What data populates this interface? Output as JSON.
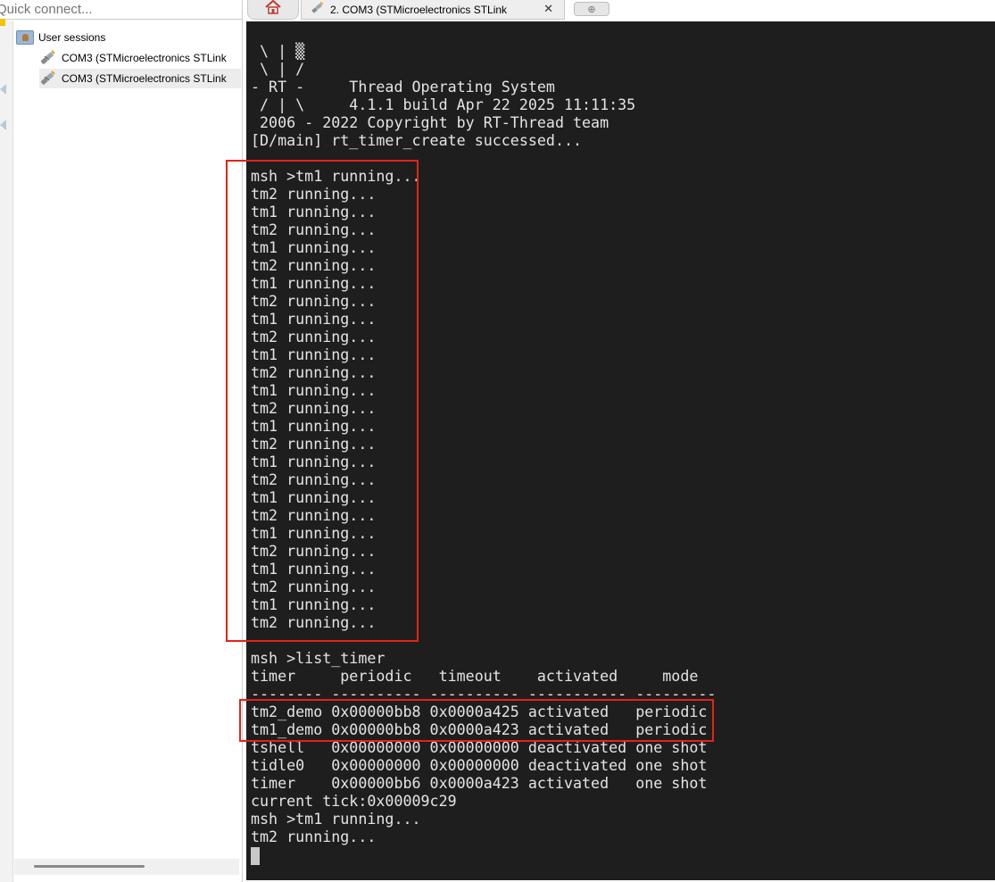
{
  "quick_connect": {
    "placeholder": "Quick connect..."
  },
  "sidebar": {
    "root": {
      "label": "User sessions",
      "icon": "user-sessions-icon"
    },
    "sessions": [
      {
        "label": "COM3  (STMicroelectronics STLink",
        "icon": "serial-plug-icon"
      },
      {
        "label": "COM3  (STMicroelectronics STLink",
        "icon": "serial-plug-icon"
      }
    ]
  },
  "tabs": {
    "home_icon": "home-icon",
    "session_tab_label": "2. COM3  (STMicroelectronics STLink",
    "close_glyph": "✕",
    "new_tab_glyph": "⊕"
  },
  "terminal": {
    "lines": [
      " \\ | ▒",
      " \\ | /",
      "- RT -     Thread Operating System",
      " / | \\     4.1.1 build Apr 22 2025 11:11:35",
      " 2006 - 2022 Copyright by RT-Thread team",
      "[D/main] rt_timer_create successed...",
      "",
      "msh >tm1 running...",
      "tm2 running...",
      "tm1 running...",
      "tm2 running...",
      "tm1 running...",
      "tm2 running...",
      "tm1 running...",
      "tm2 running...",
      "tm1 running...",
      "tm2 running...",
      "tm1 running...",
      "tm2 running...",
      "tm1 running...",
      "tm2 running...",
      "tm1 running...",
      "tm2 running...",
      "tm1 running...",
      "tm2 running...",
      "tm1 running...",
      "tm2 running...",
      "tm1 running...",
      "tm2 running...",
      "tm1 running...",
      "tm2 running...",
      "tm1 running...",
      "tm2 running...",
      "",
      "msh >list_timer",
      "timer     periodic   timeout    activated     mode",
      "-------- ---------- ---------- ----------- ---------",
      "tm2_demo 0x00000bb8 0x0000a425 activated   periodic",
      "tm1_demo 0x00000bb8 0x0000a423 activated   periodic",
      "tshell   0x00000000 0x00000000 deactivated one shot",
      "tidle0   0x00000000 0x00000000 deactivated one shot",
      "timer    0x00000bb6 0x0000a423 activated   one shot",
      "current tick:0x00009c29",
      "msh >tm1 running...",
      "tm2 running..."
    ],
    "highlight_color": "#e2231a",
    "background": "#1e1e1e",
    "foreground": "#e4e4e4"
  }
}
